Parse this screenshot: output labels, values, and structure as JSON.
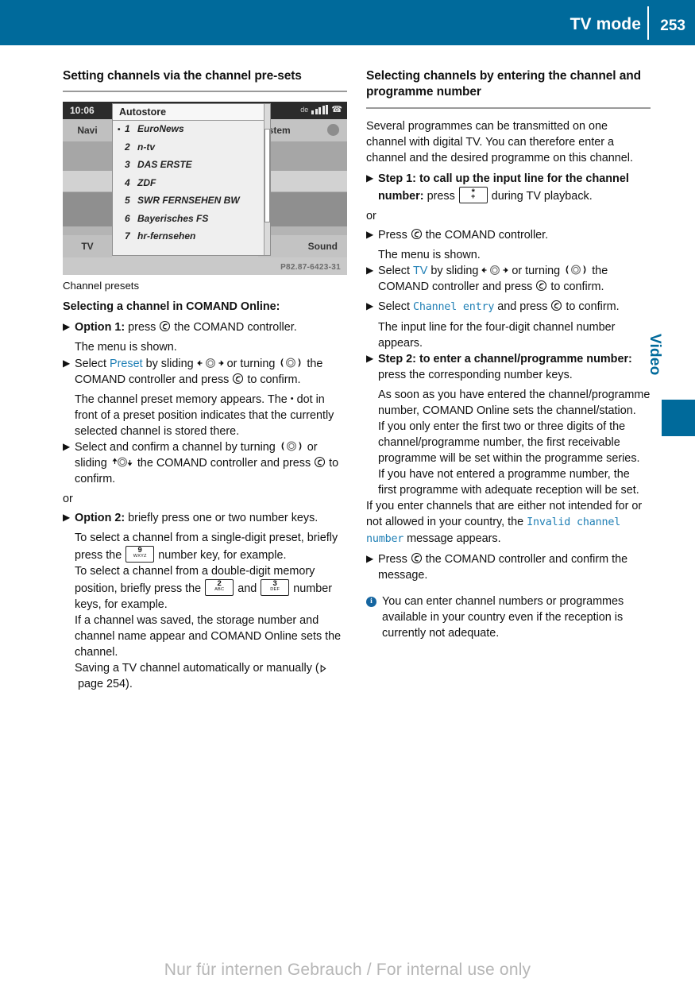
{
  "header": {
    "title": "TV mode",
    "page_number": "253"
  },
  "side_tab": {
    "label": "Video"
  },
  "watermark": "Nur für internen Gebrauch / For internal use only",
  "left_column": {
    "heading": "Setting channels via the channel pre-sets",
    "figure": {
      "time": "10:06",
      "panel_title": "Autostore",
      "status_lang": "de",
      "left_tab_top": "Navi",
      "left_tab_bottom": "TV",
      "right_tab_top": "ystem",
      "right_tab_bottom": "Sound",
      "part_number": "P82.87-6423-31",
      "presets": [
        {
          "marker": "•",
          "index": "1",
          "name": "EuroNews"
        },
        {
          "marker": "",
          "index": "2",
          "name": "n-tv"
        },
        {
          "marker": "",
          "index": "3",
          "name": "DAS ERSTE"
        },
        {
          "marker": "",
          "index": "4",
          "name": "ZDF"
        },
        {
          "marker": "",
          "index": "5",
          "name": "SWR FERNSEHEN BW"
        },
        {
          "marker": "",
          "index": "6",
          "name": "Bayerisches FS"
        },
        {
          "marker": "",
          "index": "7",
          "name": "hr-fernsehen"
        }
      ]
    },
    "caption": "Channel presets",
    "sub_heading": "Selecting a channel in COMAND Online:",
    "step1_lead": "Option 1:",
    "step1_text_a": "press",
    "step1_text_b": "the COMAND controller.",
    "step1_result": "The menu is shown.",
    "step2_a": "Select",
    "step2_term": "Preset",
    "step2_b": "by sliding",
    "step2_c": "or turning",
    "step2_d": "the COMAND controller and press",
    "step2_e": "to confirm.",
    "step2_result_a": "The channel preset memory appears. The",
    "step2_result_dot": "•",
    "step2_result_b": "dot in front of a preset position indicates that the currently selected channel is stored there.",
    "step3_a": "Select and confirm a channel by turning",
    "step3_b": "or sliding",
    "step3_c": "the COMAND controller and press",
    "step3_d": "to confirm.",
    "or": "or",
    "step4_lead": "Option 2:",
    "step4_text": "briefly press one or two number keys.",
    "para1_a": "To select a channel from a single-digit preset, briefly press the",
    "para1_key": {
      "num": "9",
      "sub": "WXYZ"
    },
    "para1_b": "number key, for example.",
    "para2_a": "To select a channel from a double-digit memory position, briefly press the",
    "para2_key1": {
      "num": "2",
      "sub": "ABC"
    },
    "para2_b": "and",
    "para2_key2": {
      "num": "3",
      "sub": "DEF"
    },
    "para2_c": "number keys, for example.",
    "para3": "If a channel was saved, the storage number and channel name appear and COMAND Online sets the channel.",
    "para4_a": "Saving a TV channel automatically or manually (",
    "para4_ref": "page 254",
    "para4_b": ")."
  },
  "right_column": {
    "heading": "Selecting channels by entering the channel and programme number",
    "intro": "Several programmes can be transmitted on one channel with digital TV. You can therefore enter a channel and the desired programme on this channel.",
    "step1_lead": "Step 1: to call up the input line for the channel number:",
    "step1_a": "press",
    "step1_key": {
      "num": "*",
      "sub": "+"
    },
    "step1_b": "during TV playback.",
    "or": "or",
    "step2_a": "Press",
    "step2_b": "the COMAND controller.",
    "step2_result": "The menu is shown.",
    "step3_a": "Select",
    "step3_term": "TV",
    "step3_b": "by sliding",
    "step3_c": "or turning",
    "step3_d": "the COMAND controller and press",
    "step3_e": "to confirm.",
    "step4_a": "Select",
    "step4_term": "Channel entry",
    "step4_b": "and press",
    "step4_c": "to confirm.",
    "step4_result": "The input line for the four-digit channel number appears.",
    "step5_lead": "Step 2: to enter a channel/programme number:",
    "step5_text": "press the corresponding number keys.",
    "para1": "As soon as you have entered the channel/programme number, COMAND Online sets the channel/station.",
    "para2": "If you only enter the first two or three digits of the channel/programme number, the first receivable programme will be set within the programme series.",
    "para3": "If you have not entered a programme number, the first programme with adequate reception will be set.",
    "para4_a": "If you enter channels that are either not intended for or not allowed in your country, the",
    "para4_term": "Invalid channel number",
    "para4_b": "message appears.",
    "step6_a": "Press",
    "step6_b": "the COMAND controller and confirm the message.",
    "note_icon": "i",
    "note_text": "You can enter channel numbers or programmes available in your country even if the reception is currently not adequate."
  }
}
